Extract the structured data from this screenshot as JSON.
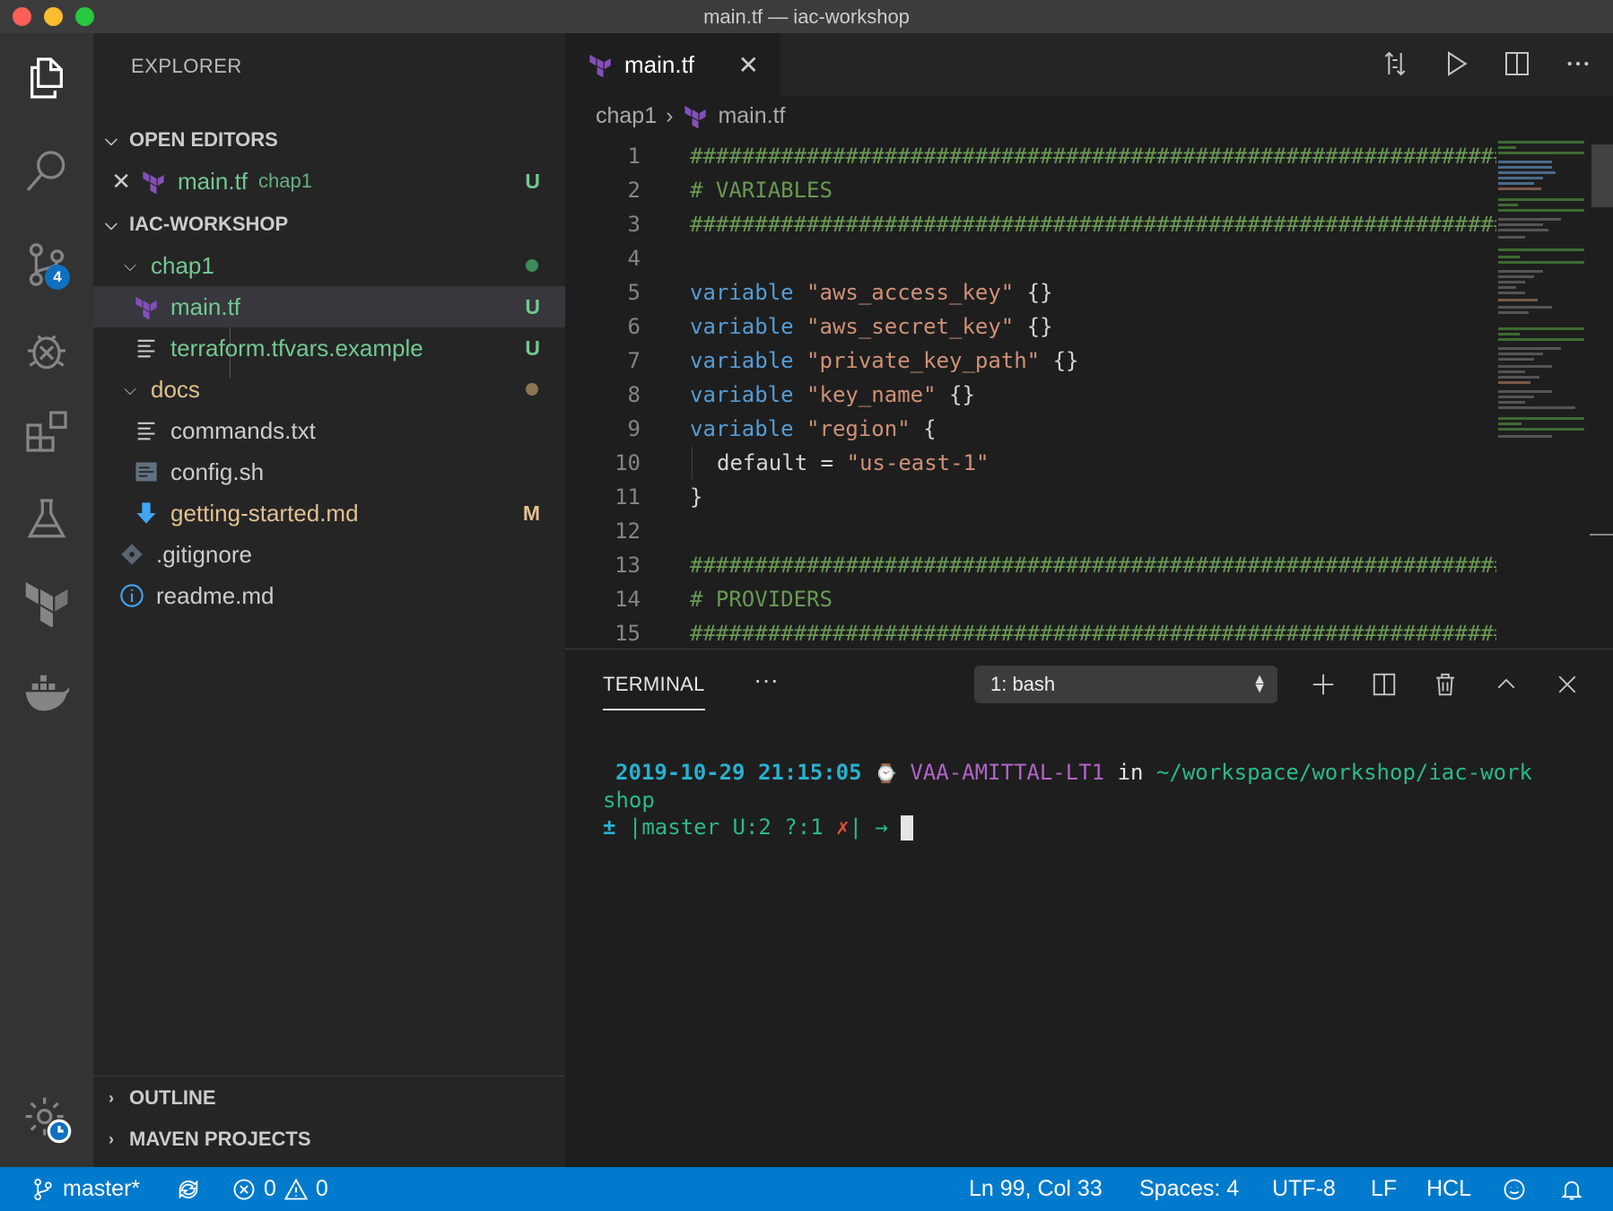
{
  "window": {
    "title": "main.tf — iac-workshop"
  },
  "sidebar": {
    "title": "EXPLORER",
    "open_editors": {
      "label": "OPEN EDITORS",
      "items": [
        {
          "name": "main.tf",
          "folder": "chap1",
          "status": "U"
        }
      ]
    },
    "workspace": {
      "label": "IAC-WORKSHOP",
      "tree": [
        {
          "name": "chap1",
          "type": "folder",
          "status": "dot"
        },
        {
          "name": "main.tf",
          "type": "terraform",
          "status": "U"
        },
        {
          "name": "terraform.tfvars.example",
          "type": "text",
          "status": "U"
        },
        {
          "name": "docs",
          "type": "folder",
          "status": "dot"
        },
        {
          "name": "commands.txt",
          "type": "text",
          "status": ""
        },
        {
          "name": "config.sh",
          "type": "shell",
          "status": ""
        },
        {
          "name": "getting-started.md",
          "type": "markdown",
          "status": "M"
        },
        {
          "name": ".gitignore",
          "type": "git",
          "status": ""
        },
        {
          "name": "readme.md",
          "type": "info",
          "status": ""
        }
      ]
    },
    "outline_label": "OUTLINE",
    "maven_label": "MAVEN PROJECTS"
  },
  "activity_bar": {
    "items": [
      "explorer-icon",
      "search-icon",
      "source-control-icon",
      "debug-icon",
      "extensions-icon",
      "test-flask-icon",
      "terraform-icon",
      "docker-icon"
    ],
    "scm_badge": "4",
    "settings": "settings-gear-icon"
  },
  "editor": {
    "tab": {
      "label": "main.tf"
    },
    "breadcrumb": {
      "folder": "chap1",
      "file": "main.tf"
    },
    "lines": [
      {
        "n": "1",
        "text": "#######################################################################"
      },
      {
        "n": "2",
        "text": "# VARIABLES"
      },
      {
        "n": "3",
        "text": "#######################################################################"
      },
      {
        "n": "4",
        "text": ""
      },
      {
        "n": "5",
        "kw": "variable",
        "str": "\"aws_access_key\"",
        "rest": " {}"
      },
      {
        "n": "6",
        "kw": "variable",
        "str": "\"aws_secret_key\"",
        "rest": " {}"
      },
      {
        "n": "7",
        "kw": "variable",
        "str": "\"private_key_path\"",
        "rest": " {}"
      },
      {
        "n": "8",
        "kw": "variable",
        "str": "\"key_name\"",
        "rest": " {}"
      },
      {
        "n": "9",
        "kw": "variable",
        "str": "\"region\"",
        "rest": " {"
      },
      {
        "n": "10",
        "attr": "default",
        "eq": " = ",
        "str": "\"us-east-1\""
      },
      {
        "n": "11",
        "text": "}"
      },
      {
        "n": "12",
        "text": ""
      },
      {
        "n": "13",
        "text": "#######################################################################"
      },
      {
        "n": "14",
        "text": "# PROVIDERS"
      },
      {
        "n": "15",
        "text": "#######################################################################"
      }
    ]
  },
  "panel": {
    "tab": "TERMINAL",
    "more": "···",
    "terminal_select": "1: bash",
    "terminal": {
      "date": "2019-10-29 21:15:05",
      "host": "VAA-AMITTAL-LT1",
      "in": "in",
      "path": "~/workspace/workshop/iac-work",
      "path_wrap": "shop",
      "prompt_pm": "±",
      "branch": "|master U:2 ?:1",
      "x": "✗",
      "prompt_end": "| →"
    }
  },
  "statusbar": {
    "branch": "master*",
    "errors": "0",
    "warnings": "0",
    "position": "Ln 99, Col 33",
    "spaces": "Spaces: 4",
    "encoding": "UTF-8",
    "eol": "LF",
    "language": "HCL"
  },
  "colors": {
    "accent": "#007acc",
    "untracked": "#73c991",
    "modified": "#e2c08d",
    "terraform": "#844fba"
  }
}
